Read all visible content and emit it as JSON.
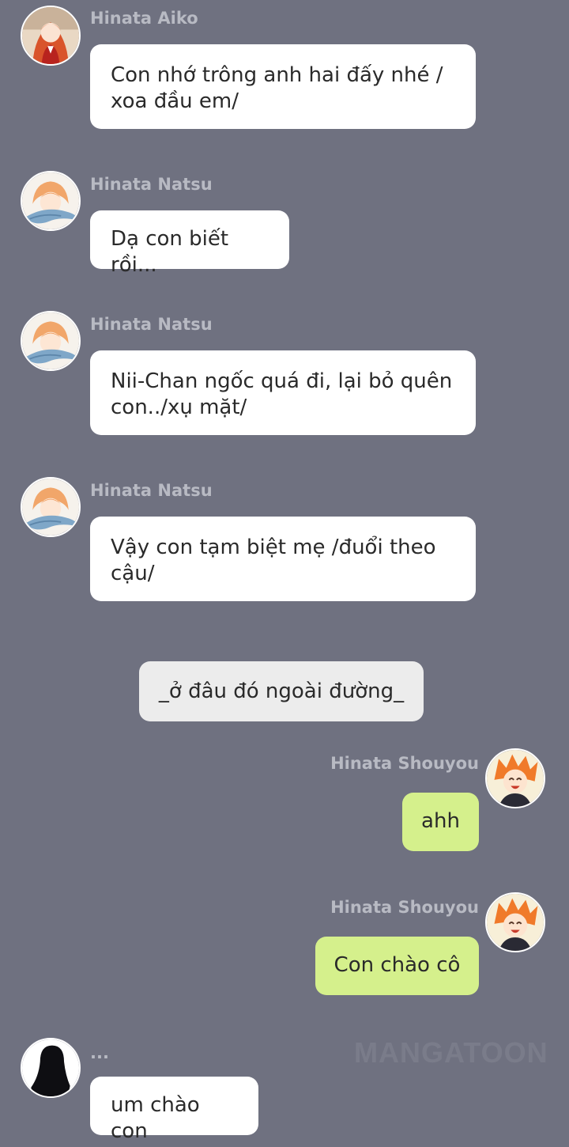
{
  "messages": [
    {
      "speaker": "Hinata Aiko",
      "text": "Con nhớ trông anh hai đấy nhé /\nxoa đầu em/"
    },
    {
      "speaker": "Hinata Natsu",
      "text": "Dạ con biết rồi..."
    },
    {
      "speaker": "Hinata Natsu",
      "text": "Nii-Chan ngốc quá đi, lại bỏ quên\ncon../xụ mặt/"
    },
    {
      "speaker": "Hinata Natsu",
      "text": "Vậy con tạm biệt mẹ /đuổi theo\ncậu/"
    },
    {
      "narration": "_ở đâu đó ngoài đường_"
    },
    {
      "speaker": "Hinata Shouyou",
      "text": "ahh"
    },
    {
      "speaker": "Hinata Shouyou",
      "text": "Con chào cô"
    },
    {
      "speaker": "...",
      "text": "um chào con"
    }
  ],
  "watermark": "MANGATOON",
  "colors": {
    "background": "#6f7180",
    "bubble_left": "#ffffff",
    "bubble_right": "#d5f08c",
    "narration": "#ececec",
    "name": "#b8bac3"
  },
  "avatars": [
    "aiko-avatar",
    "natsu-avatar",
    "shouyou-avatar",
    "silhouette-avatar"
  ]
}
